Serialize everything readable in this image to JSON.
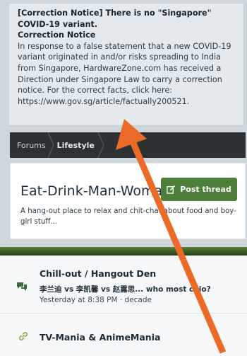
{
  "notice": {
    "title": "[Correction Notice] There is no \"Singapore\" COVID-19 variant.",
    "subtitle": "Correction Notice",
    "body": "In response to a false statement that a new COVID-19 variant originated in and/or risks spreading to India from Singapore, HardwareZone.com has received a Direction under Singapore Law to carry a correction notice. For the correct facts, click here:",
    "link": "https://www.gov.sg/article/factually200521."
  },
  "breadcrumb": {
    "items": [
      "Forums",
      "Lifestyle"
    ]
  },
  "forum": {
    "title": "Eat-Drink-Man-Woman",
    "post_button": "Post thread",
    "description": "A hang-out place to relax and chit-chat about food and boy-girl stuff..."
  },
  "nodes": [
    {
      "title": "Chill-out / Hangout Den",
      "icon": "chat-bubbles-icon",
      "last_post": "李兰迪 vs 李凯馨 vs 赵露思... who most chio?",
      "last_post_meta": "Yesterday at 8:38 PM · decade"
    },
    {
      "title": "TV-Mania & AnimeMania",
      "icon": "link-icon"
    }
  ],
  "colors": {
    "accent_green": "#4d7f3a",
    "annotation_arrow": "#ec6a27",
    "breadcrumb_bg": "#2d3133"
  }
}
